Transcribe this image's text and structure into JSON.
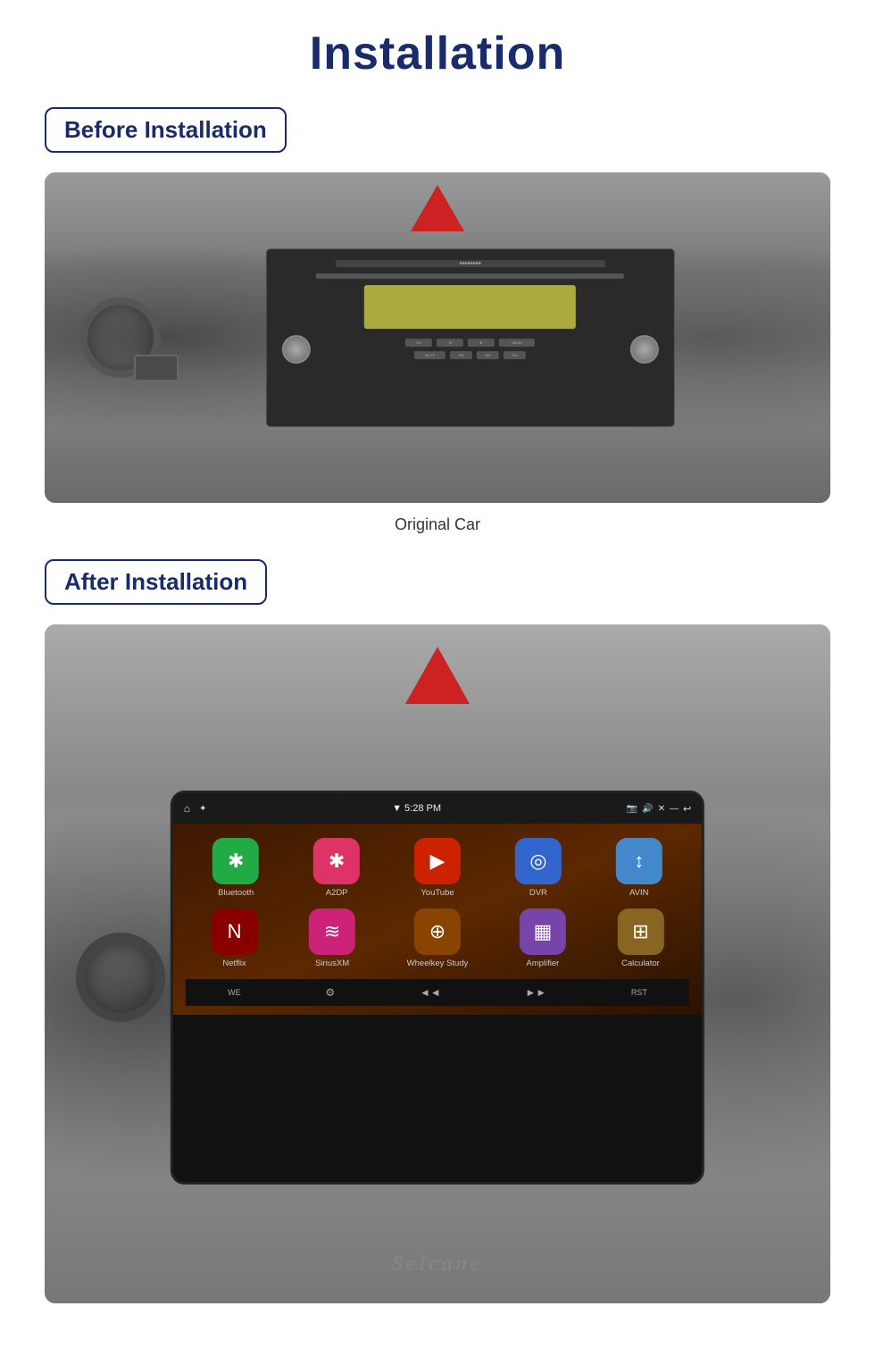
{
  "page": {
    "title": "Installation",
    "before_label": "Before Installation",
    "after_label": "After Installation",
    "original_car_caption": "Original Car",
    "seicane_brand": "Seicane"
  },
  "before_section": {
    "heading": "Before Installation",
    "caption": "Original Car"
  },
  "after_section": {
    "heading": "After Installation",
    "statusbar": {
      "time": "5:28 PM"
    },
    "apps_row1": [
      {
        "id": "bluetooth",
        "label": "Bluetooth",
        "bg": "#22aa44",
        "symbol": "✱"
      },
      {
        "id": "a2dp",
        "label": "A2DP",
        "bg": "#dd3366",
        "symbol": "✱"
      },
      {
        "id": "youtube",
        "label": "YouTube",
        "bg": "#cc2200",
        "symbol": "▶"
      },
      {
        "id": "dvr",
        "label": "DVR",
        "bg": "#3366cc",
        "symbol": "◎"
      },
      {
        "id": "avin",
        "label": "AVIN",
        "bg": "#4488cc",
        "symbol": "↕"
      }
    ],
    "apps_row2": [
      {
        "id": "netflix",
        "label": "Netflix",
        "bg": "#880000",
        "symbol": "N"
      },
      {
        "id": "siriusxm",
        "label": "SiriusXM",
        "bg": "#cc2277",
        "symbol": "≋"
      },
      {
        "id": "wheelkey",
        "label": "Wheelkey Study",
        "bg": "#884400",
        "symbol": "⊕"
      },
      {
        "id": "amplifier",
        "label": "Amplifier",
        "bg": "#7744aa",
        "symbol": "▦"
      },
      {
        "id": "calculator",
        "label": "Calculator",
        "bg": "#886622",
        "symbol": "⊞"
      }
    ]
  }
}
